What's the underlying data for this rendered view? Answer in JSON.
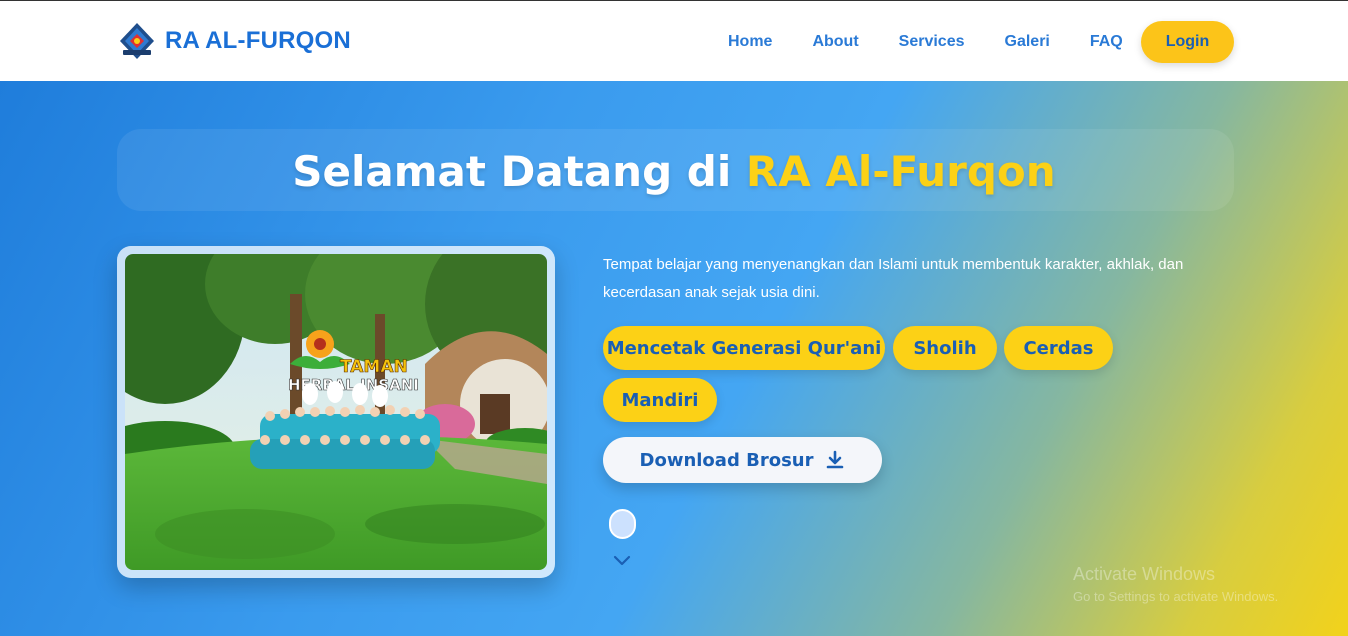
{
  "nav": {
    "brand": "RA AL-FURQON",
    "links": [
      "Home",
      "About",
      "Services",
      "Galeri",
      "FAQ"
    ],
    "login_label": "Login"
  },
  "hero": {
    "title_prefix": "Selamat Datang di ",
    "title_highlight": "RA Al-Furqon",
    "description": "Tempat belajar yang menyenangkan dan Islami untuk membentuk karakter, akhlak, dan kecerdasan anak sejak usia dini.",
    "tags": [
      "Mencetak Generasi Qur'ani",
      "Sholih",
      "Cerdas",
      "Mandiri"
    ],
    "download_label": "Download Brosur",
    "photo_sign": [
      "TAMAN",
      "HERBAL INSANI"
    ]
  },
  "watermark": {
    "title": "Activate Windows",
    "subtitle": "Go to Settings to activate Windows."
  },
  "colors": {
    "brand_blue": "#1a6fd6",
    "accent_yellow": "#fcd116",
    "hero_start": "#1f7ddb",
    "hero_end": "#f2d21b"
  },
  "icons": [
    "school-logo-icon",
    "download-icon",
    "scroll-mouse-icon",
    "chevron-down-icon"
  ]
}
